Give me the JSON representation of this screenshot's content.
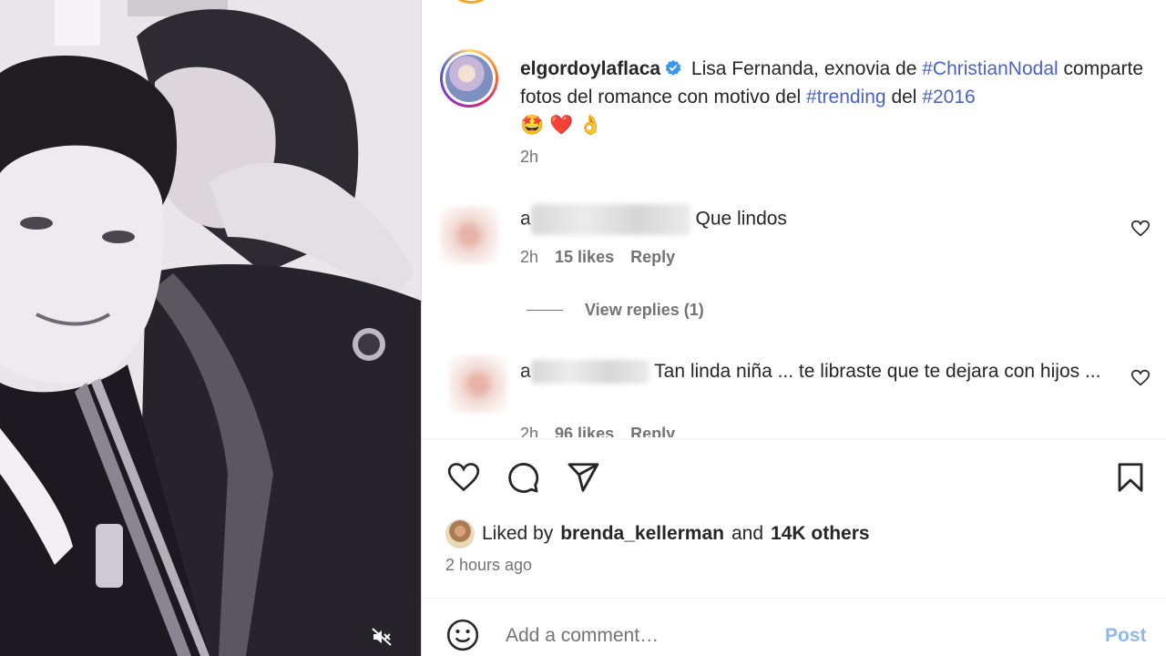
{
  "post": {
    "username": "elgordoylaflaca",
    "caption_text": "Lisa Fernanda, exnovia de",
    "hashtag_1": "#ChristianNodal",
    "caption_text_2": "comparte fotos del romance con motivo del",
    "hashtag_2": "#trending",
    "caption_text_3": "del",
    "hashtag_3": "#2016",
    "caption_emojis": "🤩❤️👌",
    "caption_time": "2h"
  },
  "comments": [
    {
      "first_letter": "a",
      "text": "Que lindos",
      "time": "2h",
      "likes": "15 likes",
      "reply": "Reply",
      "view_replies": "View replies (1)"
    },
    {
      "first_letter": "a",
      "text": "Tan linda niña ... te libraste que te dejara con hijos ...",
      "time": "2h",
      "likes": "96 likes",
      "reply": "Reply"
    }
  ],
  "likes": {
    "prefix": "Liked by",
    "liker": "brenda_kellerman",
    "conjunction": "and",
    "others": "14K others"
  },
  "post_time": "2 hours ago",
  "comment_box": {
    "placeholder": "Add a comment…",
    "post_label": "Post"
  },
  "colors": {
    "hashtag": "#4a62c8",
    "verified": "#3897f0",
    "secondary_text": "#737373",
    "post_button_disabled": "#8fb8f0"
  },
  "icons": [
    "mute-icon",
    "verified-badge-icon",
    "heart-icon",
    "comment-icon",
    "share-icon",
    "bookmark-icon",
    "emoji-icon"
  ]
}
